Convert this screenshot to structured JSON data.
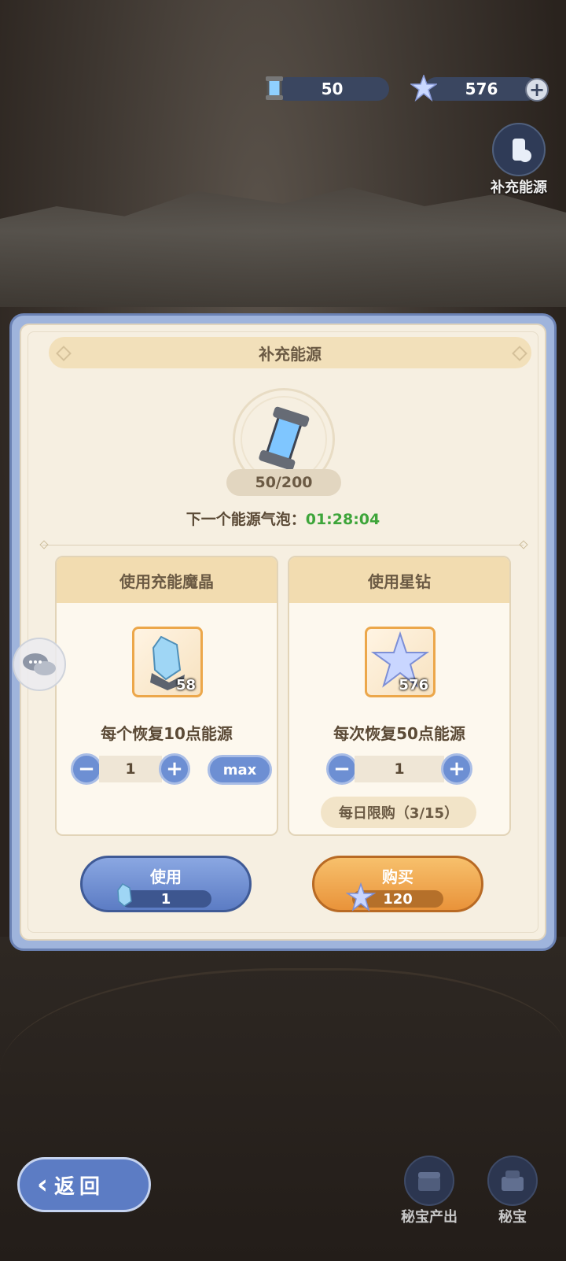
{
  "hud": {
    "energy_value": "50",
    "star_value": "576"
  },
  "side": {
    "refill_label": "补充能源",
    "treasure_output_label": "秘宝产出",
    "treasure_label": "秘宝"
  },
  "dialog": {
    "title": "补充能源",
    "energy_count": "50/200",
    "next_prefix": "下一个能源气泡：",
    "next_timer": "01:28:04",
    "crystal_card": {
      "title": "使用充能魔晶",
      "item_count": "58",
      "desc": "每个恢复10点能源",
      "qty": "1",
      "max_label": "max"
    },
    "star_card": {
      "title": "使用星钻",
      "item_count": "576",
      "desc": "每次恢复50点能源",
      "qty": "1",
      "limit": "每日限购（3/15）"
    },
    "use_button": {
      "label": "使用",
      "cost": "1"
    },
    "buy_button": {
      "label": "购买",
      "cost": "120"
    }
  },
  "back_label": "返回",
  "colors": {
    "accent_blue": "#6d8fd3",
    "accent_orange": "#e9933a",
    "timer_green": "#3ea53a"
  }
}
